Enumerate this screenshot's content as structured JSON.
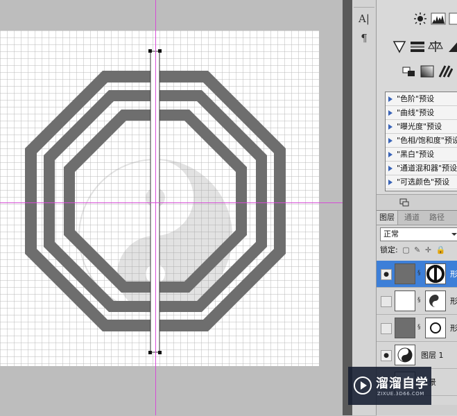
{
  "tool_column": {
    "char_tool_glyph": "A|",
    "para_tool_glyph": "¶"
  },
  "adjustments": {
    "presets": [
      "\"色阶\"预设",
      "\"曲线\"预设",
      "\"曝光度\"预设",
      "\"色相/饱和度\"预设",
      "\"黑白\"预设",
      "\"通道混和器\"预设",
      "\"可选颜色\"预设"
    ]
  },
  "layers_panel": {
    "tabs": [
      "图层",
      "通道",
      "路径"
    ],
    "blend_mode": "正常",
    "lock_label": "锁定:",
    "layers": [
      {
        "name": "形",
        "visible": true,
        "selected": true
      },
      {
        "name": "形",
        "visible": false,
        "selected": false
      },
      {
        "name": "形",
        "visible": false,
        "selected": false
      },
      {
        "name": "图层 1",
        "visible": true,
        "selected": false
      },
      {
        "name": "背景",
        "visible": true,
        "selected": false
      }
    ]
  },
  "watermark": {
    "title": "溜溜自学",
    "url": "ZIXUE.3D66.COM"
  },
  "colors": {
    "guide": "#d64bd6",
    "shape_fill": "#6e6e6e",
    "grid_line": "#b9b9b9",
    "selection": "#3d7fd8"
  }
}
